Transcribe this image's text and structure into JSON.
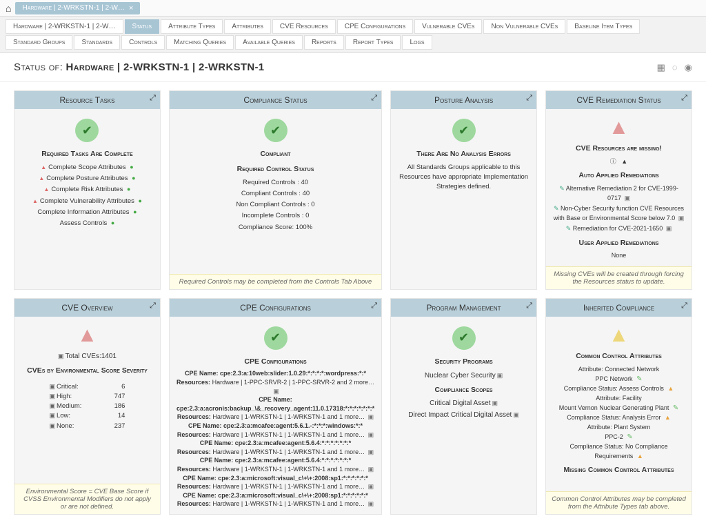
{
  "breadcrumb": {
    "home_aria": "Home",
    "tab_label": "Hardware | 2-WRKSTN-1 | 2-W…"
  },
  "tabs": {
    "row1": [
      "Hardware | 2-WRKSTN-1 | 2-W…",
      "Status",
      "Attribute Types",
      "Attributes",
      "CVE Resources",
      "CPE Configurations",
      "Vulnerable CVEs",
      "Non Vulnerable CVEs",
      "Baseline Item Types",
      "Standard Groups",
      "Standards",
      "Controls",
      "Matching Queries",
      "Available Queries"
    ],
    "row2": [
      "Reports",
      "Report Types",
      "Logs"
    ],
    "active": "Status"
  },
  "page_title": {
    "prefix": "Status of: ",
    "value": "Hardware | 2-WRKSTN-1 | 2-WRKSTN-1"
  },
  "header_icons": {
    "grid": "▦",
    "loading": "◌",
    "info": "◉"
  },
  "panels": {
    "resource_tasks": {
      "title": "Resource Tasks",
      "heading": "Required Tasks Are Complete",
      "items": [
        "Complete Scope Attributes",
        "Complete Posture Attributes",
        "Complete Risk Attributes",
        "Complete Vulnerability Attributes",
        "Complete Information Attributes",
        "Assess Controls"
      ]
    },
    "compliance_status": {
      "title": "Compliance Status",
      "heading": "Compliant",
      "sub": "Required Control Status",
      "rows": [
        "Required Controls : 40",
        "Compliant Controls : 40",
        "Non Compliant Controls : 0",
        "Incomplete Controls : 0",
        "Compliance Score: 100%"
      ],
      "footer": "Required Controls may be completed from the Controls Tab Above"
    },
    "posture": {
      "title": "Posture Analysis",
      "heading": "There Are No Analysis Errors",
      "body": "All Standards Groups applicable to this Resources have appropriate Implementation Strategies defined."
    },
    "cve_remediation": {
      "title": "CVE Remediation Status",
      "heading": "CVE Resources are missing!",
      "sub1": "Auto Applied Remediations",
      "items": [
        "Alternative Remediation 2 for CVE-1999-0717",
        "Non-Cyber Security function CVE Resources with Base or Environmental Score below 7.0",
        "Remediation for CVE-2021-1650"
      ],
      "sub2": "User Applied Remediations",
      "none": "None",
      "footer": "Missing CVEs will be created through forcing the Resources status to update."
    },
    "cve_overview": {
      "title": "CVE Overview",
      "total_label": "Total CVEs:",
      "total": "1401",
      "sub": "CVEs by Environmental Score Severity",
      "rows": [
        {
          "label": "Critical:",
          "val": "6"
        },
        {
          "label": "High:",
          "val": "747"
        },
        {
          "label": "Medium:",
          "val": "186"
        },
        {
          "label": "Low:",
          "val": "14"
        },
        {
          "label": "None:",
          "val": "237"
        }
      ],
      "footer": "Environmental Score = CVE Base Score if CVSS Environmental Modifiers do not apply or are not defined."
    },
    "cpe": {
      "title": "CPE Configurations",
      "sub": "CPE Configurations",
      "entries": [
        {
          "name": "CPE Name: cpe:2.3:a:10web:slider:1.0.29:*:*:*:*:wordpress:*:*",
          "res": "Resources: Hardware | 1-PPC-SRVR-2 | 1-PPC-SRVR-2 and 2 more…"
        },
        {
          "name": "CPE Name: cpe:2.3:a:acronis:backup_\\&_recovery_agent:11.0.17318:*:*:*:*:*:*:*",
          "res": "Resources: Hardware | 1-WRKSTN-1 | 1-WRKSTN-1 and 1 more…"
        },
        {
          "name": "CPE Name: cpe:2.3:a:mcafee:agent:5.6.1.-:*:*:*:windows:*:*",
          "res": "Resources: Hardware | 1-WRKSTN-1 | 1-WRKSTN-1 and 1 more…"
        },
        {
          "name": "CPE Name: cpe:2.3:a:mcafee:agent:5.6.4:*:*:*:*:*:*:*",
          "res": "Resources: Hardware | 1-WRKSTN-1 | 1-WRKSTN-1 and 1 more…"
        },
        {
          "name": "CPE Name: cpe:2.3:a:mcafee:agent:5.6.4:*:*:*:*:*:*:*",
          "res": "Resources: Hardware | 1-WRKSTN-1 | 1-WRKSTN-1 and 1 more…"
        },
        {
          "name": "CPE Name: cpe:2.3:a:microsoft:visual_c\\+\\+:2008:sp1:*:*:*:*:*:*",
          "res": "Resources: Hardware | 1-WRKSTN-1 | 1-WRKSTN-1 and 1 more…"
        },
        {
          "name": "CPE Name: cpe:2.3:a:microsoft:visual_c\\+\\+:2008:sp1:*:*:*:*:*:*",
          "res": "Resources: Hardware | 1-WRKSTN-1 | 1-WRKSTN-1 and 1 more…"
        }
      ]
    },
    "program": {
      "title": "Program Management",
      "sub1": "Security Programs",
      "p1": "Nuclear Cyber Security",
      "sub2": "Compliance Scopes",
      "p2": "Critical Digital Asset",
      "p3": "Direct Impact Critical Digital Asset"
    },
    "inherited": {
      "title": "Inherited Compliance",
      "sub": "Common Control Attributes",
      "blocks": [
        {
          "attr": "Attribute: Connected Network",
          "name": "PPC Network",
          "status": "Compliance Status: Assess Controls"
        },
        {
          "attr": "Attribute: Facility",
          "name": "Mount Vernon Nuclear Generating Plant",
          "status": "Compliance Status: Analysis Error"
        },
        {
          "attr": "Attribute: Plant System",
          "name": "PPC-2",
          "status": "Compliance Status: No Compliance Requirements"
        }
      ],
      "more": "Missing Common Control Attributes",
      "footer": "Common Control Attributes may be completed from the Attribute Types tab above."
    }
  }
}
